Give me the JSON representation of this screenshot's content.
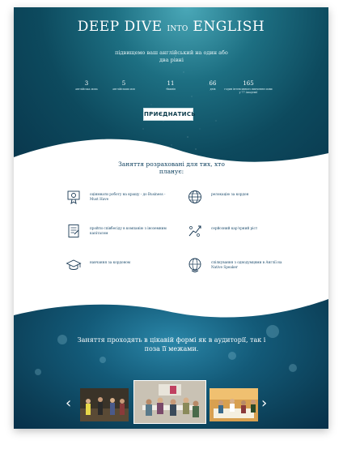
{
  "hero": {
    "title_part1": "DEEP DIVE ",
    "title_small": "INTO",
    "title_part2": " ENGLISH",
    "subtitle": "підвищемо ваш англійський на один або два рівні",
    "stats": [
      {
        "num": "3",
        "label": "англійська мова"
      },
      {
        "num": "5",
        "label": "англійських мов"
      },
      {
        "num": "11",
        "label": "тижнів"
      },
      {
        "num": "66",
        "label": "днів"
      },
      {
        "num": "165",
        "label": "годин інтенсивного вивчення мови у 77 Академії"
      }
    ],
    "cta_label": "ПРИЄДНАТИСЬ"
  },
  "features": {
    "heading": "Заняття розраховані для тих, хто планує:",
    "items": [
      {
        "icon": "certificate-icon",
        "text": "оцінювати роботу на кращу - до Business - Must Have"
      },
      {
        "icon": "globe-icon",
        "text": "релокацію за кордон"
      },
      {
        "icon": "document-icon",
        "text": "пройти співбесіду в компанію з іноземним капіталом"
      },
      {
        "icon": "growth-icon",
        "text": "серйозний кар'єрний ріст"
      },
      {
        "icon": "graduation-cap-icon",
        "text": "навчання за кордоном"
      },
      {
        "icon": "globe-chat-icon",
        "text": "спілкування з однодумцями в Англії на Native Speaker"
      }
    ]
  },
  "bottom": {
    "text": "Заняття проходять в цікавій формі як в аудиторії, так і поза її межами.",
    "prev_arrow": "‹",
    "next_arrow": "›",
    "photos": [
      "photo-group-1",
      "photo-classroom",
      "photo-group-2"
    ]
  }
}
